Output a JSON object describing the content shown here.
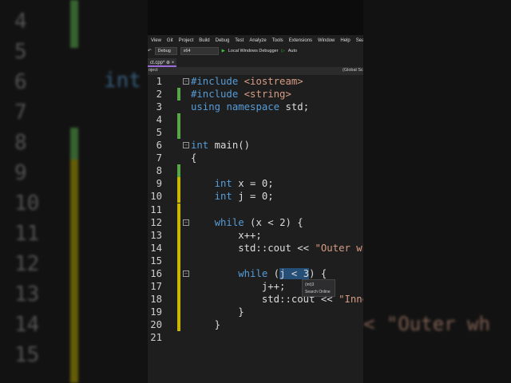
{
  "menu": [
    "View",
    "Git",
    "Project",
    "Build",
    "Debug",
    "Test",
    "Analyze",
    "Tools",
    "Extensions",
    "Window",
    "Help",
    "Sear"
  ],
  "toolbar": {
    "config": "Debug",
    "platform": "x64",
    "run_label": "Local Windows Debugger",
    "auto": "Auto"
  },
  "tab": {
    "title": "ct.cpp*",
    "pin": "⊕",
    "close": "×"
  },
  "navbar": {
    "project": "oject",
    "scope": "(Global Sc"
  },
  "lines": [
    {
      "n": "1",
      "t": "#include <iostream>"
    },
    {
      "n": "2",
      "t": "#include <string>"
    },
    {
      "n": "3",
      "t": "using namespace std;"
    },
    {
      "n": "4",
      "t": ""
    },
    {
      "n": "5",
      "t": ""
    },
    {
      "n": "6",
      "t": "int main()"
    },
    {
      "n": "7",
      "t": "{"
    },
    {
      "n": "8",
      "t": ""
    },
    {
      "n": "9",
      "t": "    int x = 0;"
    },
    {
      "n": "10",
      "t": "    int j = 0;"
    },
    {
      "n": "11",
      "t": ""
    },
    {
      "n": "12",
      "t": "    while (x < 2) {"
    },
    {
      "n": "13",
      "t": "        x++;"
    },
    {
      "n": "14",
      "t": "        std::cout << \"Outer wh"
    },
    {
      "n": "15",
      "t": ""
    },
    {
      "n": "16",
      "t": "        while (j < 3) {"
    },
    {
      "n": "17",
      "t": "            j++;"
    },
    {
      "n": "18",
      "t": "            std::cout << \"Inne"
    },
    {
      "n": "19",
      "t": "        }"
    },
    {
      "n": "20",
      "t": "    }"
    },
    {
      "n": "21",
      "t": ""
    }
  ],
  "tooltip": {
    "value": "(int)3",
    "action": "Search Online"
  },
  "background": {
    "left_numbers": [
      "4",
      "5",
      "6",
      "7",
      "8",
      "9",
      "10",
      "11",
      "12",
      "13",
      "14",
      "15"
    ],
    "left_code": "int",
    "right_code": "< \"Outer wh"
  },
  "colors": {
    "keyword": "#569cd6",
    "string": "#d69d85",
    "saved_change": "#57a64a",
    "unsaved_change": "#c8b600"
  }
}
